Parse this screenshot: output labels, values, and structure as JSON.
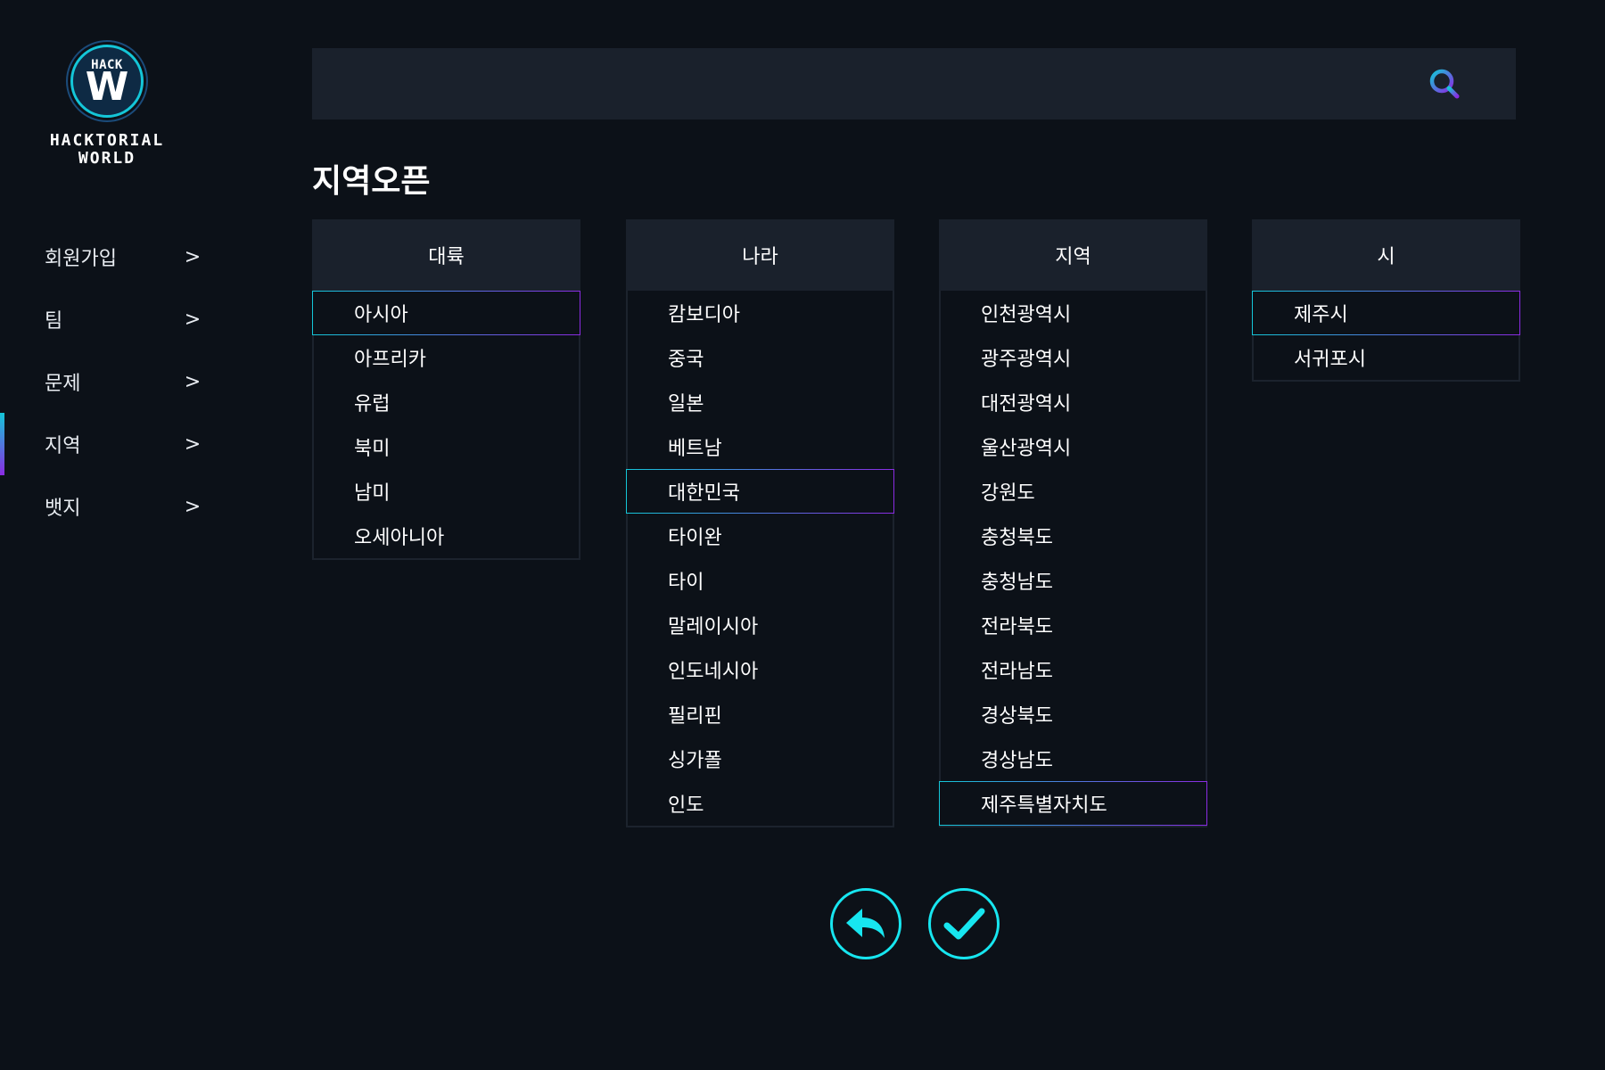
{
  "brand": {
    "badge_top": "HACK",
    "badge_letter": "W",
    "name_line1": "HACKTORIAL",
    "name_line2": "WORLD"
  },
  "sidebar": {
    "items": [
      {
        "label": "회원가입",
        "arrow": ">"
      },
      {
        "label": "팀",
        "arrow": ">"
      },
      {
        "label": "문제",
        "arrow": ">"
      },
      {
        "label": "지역",
        "arrow": ">",
        "active": true
      },
      {
        "label": "뱃지",
        "arrow": ">"
      }
    ]
  },
  "search": {
    "value": "",
    "placeholder": ""
  },
  "page_title": "지역오픈",
  "columns": [
    {
      "header": "대륙",
      "items": [
        "아시아",
        "아프리카",
        "유럽",
        "북미",
        "남미",
        "오세아니아"
      ],
      "selected_index": 0
    },
    {
      "header": "나라",
      "items": [
        "캄보디아",
        "중국",
        "일본",
        "베트남",
        "대한민국",
        "타이완",
        "타이",
        "말레이시아",
        "인도네시아",
        "필리핀",
        "싱가폴",
        "인도"
      ],
      "selected_index": 4
    },
    {
      "header": "지역",
      "items": [
        "인천광역시",
        "광주광역시",
        "대전광역시",
        "울산광역시",
        "강원도",
        "충청북도",
        "충청남도",
        "전라북도",
        "전라남도",
        "경상북도",
        "경상남도",
        "제주특별자치도"
      ],
      "selected_index": 11
    },
    {
      "header": "시",
      "items": [
        "제주시",
        "서귀포시"
      ],
      "selected_index": 0
    }
  ],
  "actions": {
    "back_icon": "reply-arrow-icon",
    "confirm_icon": "checkmark-icon"
  },
  "colors": {
    "background": "#0c1118",
    "panel": "#1a212c",
    "accent_cyan": "#17e6f0",
    "accent_purple": "#8a2be2"
  }
}
